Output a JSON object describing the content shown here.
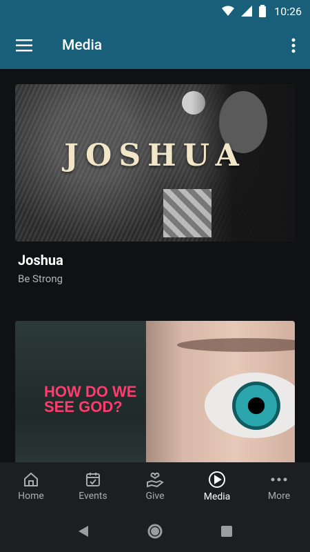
{
  "status_bar": {
    "time": "10:26"
  },
  "app_bar": {
    "title": "Media"
  },
  "cards": [
    {
      "art_title": "JOSHUA",
      "title": "Joshua",
      "subtitle": "Be Strong"
    },
    {
      "art_title_line1": "HOW DO WE",
      "art_title_line2": "SEE GOD?"
    }
  ],
  "bottom_nav": [
    {
      "label": "Home",
      "icon": "home-icon"
    },
    {
      "label": "Events",
      "icon": "calendar-icon"
    },
    {
      "label": "Give",
      "icon": "give-icon"
    },
    {
      "label": "Media",
      "icon": "play-circle-icon",
      "active": true
    },
    {
      "label": "More",
      "icon": "more-horizontal-icon"
    }
  ],
  "colors": {
    "app_bar": "#1a5f7a",
    "background": "#0f1114",
    "accent": "#ff3c6f"
  }
}
